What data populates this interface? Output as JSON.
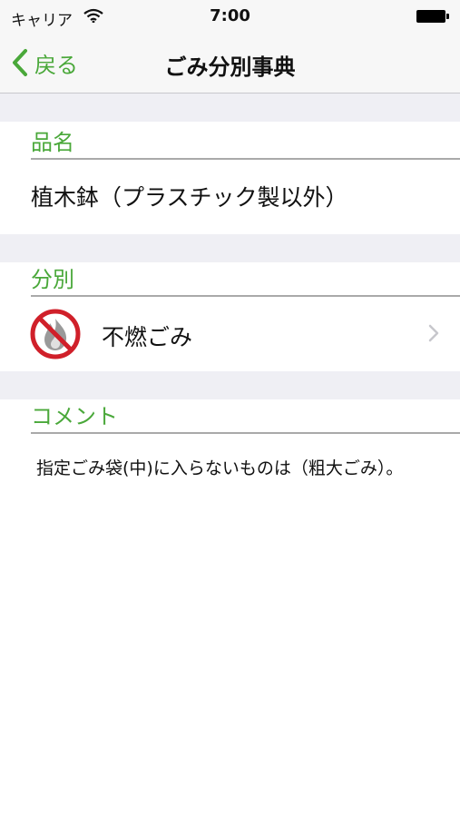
{
  "status_bar": {
    "carrier": "キャリア",
    "time": "7:00"
  },
  "nav": {
    "back_label": "戻る",
    "title": "ごみ分別事典"
  },
  "sections": {
    "name_header": "品名",
    "name_value": "植木鉢（プラスチック製以外）",
    "category_header": "分別",
    "category_value": "不燃ごみ",
    "comment_header": "コメント",
    "comment_text": "指定ごみ袋(中)に入らないものは（粗大ごみ）。"
  },
  "colors": {
    "accent": "#4aa83a",
    "prohibit": "#d0202a",
    "separator_bg": "#efeff4"
  },
  "icons": {
    "back": "chevron-left-icon",
    "category": "no-burn-icon",
    "disclosure": "chevron-right-icon"
  }
}
